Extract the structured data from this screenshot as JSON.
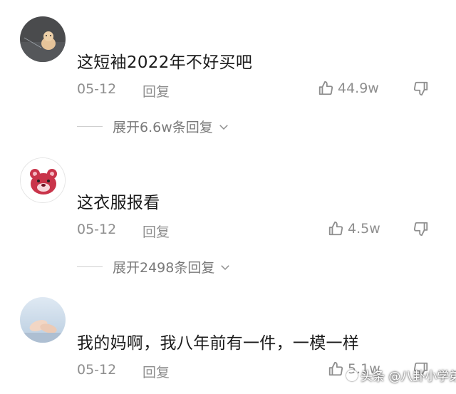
{
  "comments": [
    {
      "text": "这短袖2022年不好买吧",
      "date": "05-12",
      "reply_label": "回复",
      "likes": "44.9w",
      "expand_label": "展开6.6w条回复",
      "avatar": "dog-on-asphalt-avatar"
    },
    {
      "text": "这衣服报看",
      "date": "05-12",
      "reply_label": "回复",
      "likes": "4.5w",
      "expand_label": "展开2498条回复",
      "avatar": "red-bear-avatar"
    },
    {
      "text": "我的妈啊，我八年前有一件，一模一样",
      "date": "05-12",
      "reply_label": "回复",
      "likes": "5.1w",
      "avatar": "hands-photo-avatar"
    }
  ],
  "watermark": "头条 @八卦小学弟",
  "icons": {
    "like": "thumbs-up-icon",
    "dislike": "thumbs-down-icon",
    "expand": "chevron-down-icon"
  }
}
